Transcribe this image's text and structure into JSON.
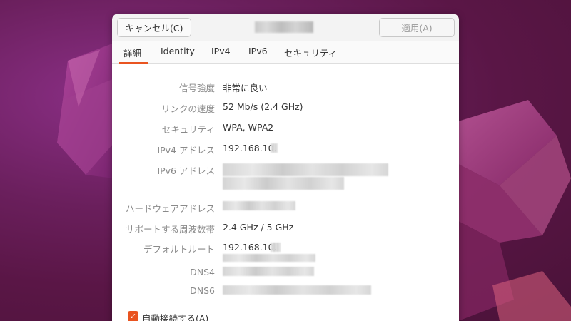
{
  "header": {
    "cancel_label": "キャンセル(C)",
    "apply_label": "適用(A)"
  },
  "tabs": [
    {
      "label": "詳細",
      "active": true
    },
    {
      "label": "Identity",
      "active": false
    },
    {
      "label": "IPv4",
      "active": false
    },
    {
      "label": "IPv6",
      "active": false
    },
    {
      "label": "セキュリティ",
      "active": false
    }
  ],
  "details": {
    "signal_strength": {
      "label": "信号強度",
      "value": "非常に良い"
    },
    "link_speed": {
      "label": "リンクの速度",
      "value": "52 Mb/s (2.4 GHz)"
    },
    "security": {
      "label": "セキュリティ",
      "value": "WPA, WPA2"
    },
    "ipv4": {
      "label": "IPv4 アドレス",
      "value": "192.168.10."
    },
    "ipv6": {
      "label": "IPv6 アドレス"
    },
    "hw_address": {
      "label": "ハードウェアアドレス"
    },
    "bands": {
      "label": "サポートする周波数帯",
      "value": "2.4 GHz / 5 GHz"
    },
    "default_route": {
      "label": "デフォルトルート",
      "value": "192.168.10."
    },
    "dns4": {
      "label": "DNS4"
    },
    "dns6": {
      "label": "DNS6"
    }
  },
  "auto_connect": {
    "label": "自動接続する(A)",
    "checked": true
  },
  "colors": {
    "accent": "#e95420",
    "wallpaper": "#6a1f5c"
  }
}
